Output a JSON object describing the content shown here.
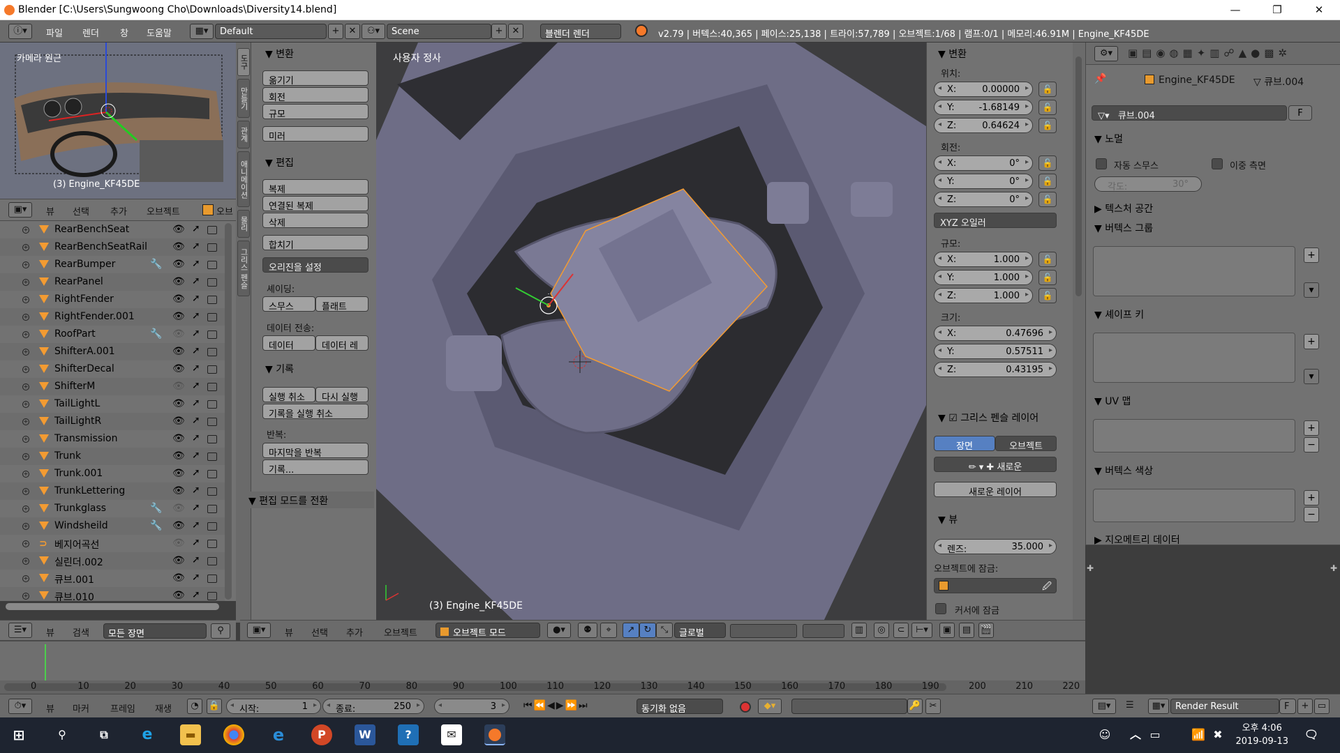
{
  "window": {
    "title": "Blender [C:\\Users\\Sungwoong Cho\\Downloads\\Diversity14.blend]",
    "minimize": "—",
    "maximize": "❐",
    "close": "✕"
  },
  "menu": {
    "file": "파일",
    "render": "렌더",
    "window": "창",
    "help": "도움말"
  },
  "layout": {
    "screen": "Default",
    "scene": "Scene",
    "engine": "블렌더 렌더"
  },
  "stats": "v2.79 | 버텍스:40,365 | 페이스:25,138 | 트라이:57,789 | 오브젝트:1/68 | 램프:0/1 | 메모리:46.91M | Engine_KF45DE",
  "camera_view": {
    "label": "카메라 원근",
    "object": "(3) Engine_KF45DE"
  },
  "outliner_header": {
    "view": "뷰",
    "select": "선택",
    "add": "추가",
    "object": "오브젝트",
    "obj_short": "오브"
  },
  "outliner": {
    "items": [
      {
        "name": "RearBenchSeat",
        "type": "mesh",
        "visible": true,
        "modifier": false
      },
      {
        "name": "RearBenchSeatRail",
        "type": "mesh",
        "visible": true,
        "modifier": false
      },
      {
        "name": "RearBumper",
        "type": "mesh",
        "visible": true,
        "modifier": true
      },
      {
        "name": "RearPanel",
        "type": "mesh",
        "visible": true,
        "modifier": false
      },
      {
        "name": "RightFender",
        "type": "mesh",
        "visible": true,
        "modifier": false
      },
      {
        "name": "RightFender.001",
        "type": "mesh",
        "visible": true,
        "modifier": false
      },
      {
        "name": "RoofPart",
        "type": "mesh",
        "visible": false,
        "modifier": true
      },
      {
        "name": "ShifterA.001",
        "type": "mesh",
        "visible": true,
        "modifier": false
      },
      {
        "name": "ShifterDecal",
        "type": "mesh",
        "visible": true,
        "modifier": false
      },
      {
        "name": "ShifterM",
        "type": "mesh",
        "visible": false,
        "modifier": false
      },
      {
        "name": "TailLightL",
        "type": "mesh",
        "visible": true,
        "modifier": false
      },
      {
        "name": "TailLightR",
        "type": "mesh",
        "visible": true,
        "modifier": false
      },
      {
        "name": "Transmission",
        "type": "mesh",
        "visible": true,
        "modifier": false
      },
      {
        "name": "Trunk",
        "type": "mesh",
        "visible": true,
        "modifier": false
      },
      {
        "name": "Trunk.001",
        "type": "mesh",
        "visible": true,
        "modifier": false
      },
      {
        "name": "TrunkLettering",
        "type": "mesh",
        "visible": true,
        "modifier": false
      },
      {
        "name": "Trunkglass",
        "type": "mesh",
        "visible": false,
        "modifier": true
      },
      {
        "name": "Windsheild",
        "type": "mesh",
        "visible": true,
        "modifier": true
      },
      {
        "name": "베지어곡선",
        "type": "curve",
        "visible": false,
        "modifier": false
      },
      {
        "name": "실린더.002",
        "type": "mesh",
        "visible": true,
        "modifier": false
      },
      {
        "name": "큐브.001",
        "type": "mesh",
        "visible": true,
        "modifier": false
      },
      {
        "name": "큐브.010",
        "type": "mesh",
        "visible": true,
        "modifier": false
      }
    ]
  },
  "outliner_footer": {
    "view": "뷰",
    "search": "검색",
    "scenes": "모든 장면"
  },
  "tool_tabs": [
    "도구",
    "만들기",
    "관계",
    "애니메이션",
    "물리",
    "그리스 펜슬"
  ],
  "tools": {
    "transform": {
      "header": "변환",
      "move": "옮기기",
      "rotate": "회전",
      "scale": "규모",
      "mirror": "미러"
    },
    "edit": {
      "header": "편집",
      "duplicate": "복제",
      "linked_duplicate": "연결된 복제",
      "delete": "삭제",
      "join": "합치기",
      "origin": "오리진을 설정",
      "shading_label": "셰이딩:",
      "smooth": "스무스",
      "flat": "플래트",
      "data_transfer_label": "데이터 전송:",
      "data": "데이터",
      "data_layout": "데이터 레"
    },
    "history": {
      "header": "기록",
      "undo": "실행 취소",
      "redo": "다시 실행",
      "undo_history": "기록을 실행 취소",
      "repeat_label": "반복:",
      "repeat_last": "마지막을 반복",
      "repeat_history": "기록..."
    },
    "mode_toggle": "편집 모드를 전환"
  },
  "viewport": {
    "label": "사용자 정사",
    "object": "(3) Engine_KF45DE"
  },
  "viewport_header": {
    "view": "뷰",
    "select": "선택",
    "add": "추가",
    "object": "오브젝트",
    "mode": "오브젝트 모드",
    "orientation": "글로벌"
  },
  "npanel": {
    "transform_header": "변환",
    "location_label": "위치:",
    "location": {
      "x": "0.00000",
      "y": "-1.68149",
      "z": "0.64624"
    },
    "rotation_label": "회전:",
    "rotation": {
      "x": "0°",
      "y": "0°",
      "z": "0°"
    },
    "rotation_mode": "XYZ 오일러",
    "scale_label": "규모:",
    "scale": {
      "x": "1.000",
      "y": "1.000",
      "z": "1.000"
    },
    "dimensions_label": "크기:",
    "dimensions": {
      "x": "0.47696",
      "y": "0.57511",
      "z": "0.43195"
    },
    "axis": {
      "x": "X:",
      "y": "Y:",
      "z": "Z:"
    },
    "gp_header": "그리스 펜슬 레이어",
    "scene_tab": "장면",
    "object_tab": "오브젝트",
    "new": "새로운",
    "new_layer": "새로운 레이어",
    "view_header": "뷰",
    "lens_label": "렌즈:",
    "lens": "35.000",
    "lock_to_object": "오브젝트에 잠금:",
    "lock_cursor": "커서에 잠금"
  },
  "props": {
    "breadcrumb_object": "Engine_KF45DE",
    "breadcrumb_mesh": "큐브.004",
    "mesh_name": "큐브.004",
    "fake_user": "F",
    "normals_header": "노멀",
    "auto_smooth": "자동 스무스",
    "double_sided": "이중 측면",
    "angle_label": "각도:",
    "angle": "30°",
    "texture_space": "텍스처 공간",
    "vertex_groups": "버텍스 그룹",
    "shape_keys": "셰이프 키",
    "uv_maps": "UV 맵",
    "vertex_colors": "버텍스 색상",
    "geometry_data": "지오메트리 데이터"
  },
  "timeline": {
    "ticks": [
      "0",
      "10",
      "20",
      "30",
      "40",
      "50",
      "60",
      "70",
      "80",
      "90",
      "100",
      "110",
      "120",
      "130",
      "140",
      "150",
      "160",
      "170",
      "180",
      "190",
      "200",
      "210",
      "220"
    ],
    "view": "뷰",
    "marker": "마커",
    "frame": "프레임",
    "playback": "재생",
    "start_label": "시작:",
    "start": "1",
    "end_label": "종료:",
    "end": "250",
    "current": "3",
    "sync": "동기화 없음"
  },
  "image_header": {
    "name": "Render Result",
    "fake": "F"
  },
  "taskbar": {
    "time": "오후 4:06",
    "date": "2019-09-13"
  },
  "colors": {
    "accent_blue": "#5680c2",
    "selection_orange": "#f39b32",
    "blender_orange": "#f5792a"
  }
}
